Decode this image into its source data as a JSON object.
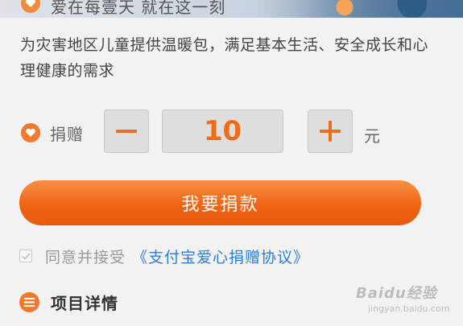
{
  "banner": {
    "title": "爱在每壹天 就在这一刻"
  },
  "project": {
    "description": "为灾害地区儿童提供温暖包，满足基本生活、安全成长和心理健康的需求"
  },
  "donation": {
    "label": "捐赠",
    "minus_label": "−",
    "amount": "10",
    "plus_label": "+",
    "unit": "元"
  },
  "actions": {
    "donate_label": "我要捐款"
  },
  "agreement": {
    "checked": true,
    "text": "同意并接受",
    "link": "《支付宝爱心捐赠协议》"
  },
  "details": {
    "title": "项目详情"
  },
  "watermark": {
    "text": "Baidu经验",
    "sub": "jingyan.baidu.com"
  },
  "colors": {
    "accent": "#f07a2b",
    "amount": "#f06c1a",
    "link": "#2a7fd8",
    "background": "#f2f2f2"
  },
  "icons": [
    "heart-icon",
    "minus-icon",
    "plus-icon",
    "checkbox-check-icon",
    "list-icon"
  ]
}
